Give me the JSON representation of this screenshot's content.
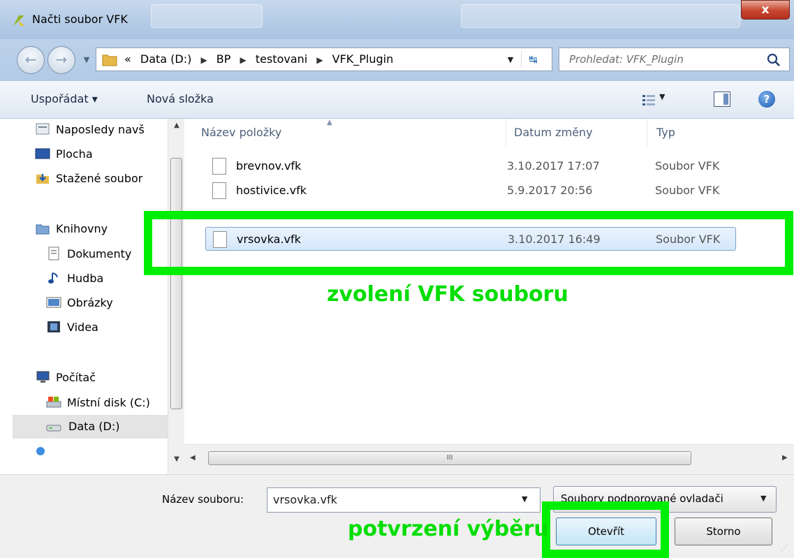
{
  "window": {
    "title": "Načti soubor VFK",
    "close_label": "x"
  },
  "nav": {
    "breadcrumb": [
      "«",
      "Data (D:)",
      "BP",
      "testovani",
      "VFK_Plugin"
    ],
    "search_placeholder": "Prohledat: VFK_Plugin"
  },
  "toolbar": {
    "organize_label": "Uspořádat ▾",
    "new_folder_label": "Nová složka",
    "help_label": "?"
  },
  "sidebar": {
    "items": [
      {
        "label": "Naposledy navš",
        "icon": "recent-places-icon"
      },
      {
        "label": "Plocha",
        "icon": "desktop-icon"
      },
      {
        "label": "Stažené soubor",
        "icon": "downloads-icon"
      },
      {
        "label": "Knihovny",
        "icon": "libraries-icon"
      },
      {
        "label": "Dokumenty",
        "icon": "documents-icon"
      },
      {
        "label": "Hudba",
        "icon": "music-icon"
      },
      {
        "label": "Obrázky",
        "icon": "pictures-icon"
      },
      {
        "label": "Videa",
        "icon": "videos-icon"
      },
      {
        "label": "Počítač",
        "icon": "computer-icon"
      },
      {
        "label": "Místní disk (C:)",
        "icon": "local-disk-icon"
      },
      {
        "label": "Data (D:)",
        "icon": "drive-icon"
      }
    ],
    "selected": "Data (D:)"
  },
  "filelist": {
    "columns": [
      "Název položky",
      "Datum změny",
      "Typ"
    ],
    "rows": [
      {
        "name": "brevnov.vfk",
        "date": "3.10.2017 17:07",
        "type": "Soubor VFK",
        "selected": false
      },
      {
        "name": "hostivice.vfk",
        "date": "5.9.2017 20:56",
        "type": "Soubor VFK",
        "selected": false
      },
      {
        "name": "vrsovka.vfk",
        "date": "3.10.2017 16:49",
        "type": "Soubor VFK",
        "selected": true
      }
    ],
    "hscroll_grip": "III"
  },
  "bottom": {
    "filename_label": "Název souboru:",
    "filename_value": "vrsovka.vfk",
    "filter_value": "Soubory podporované ovladači",
    "open_label": "Otevřít",
    "cancel_label": "Storno"
  },
  "annotations": {
    "select_text": "zvolení VFK souboru",
    "confirm_text": "potvrzení výběru",
    "color": "#00ee00"
  },
  "colors": {
    "selection": "#d5e7fb",
    "accent_blue": "#1a59b3"
  }
}
